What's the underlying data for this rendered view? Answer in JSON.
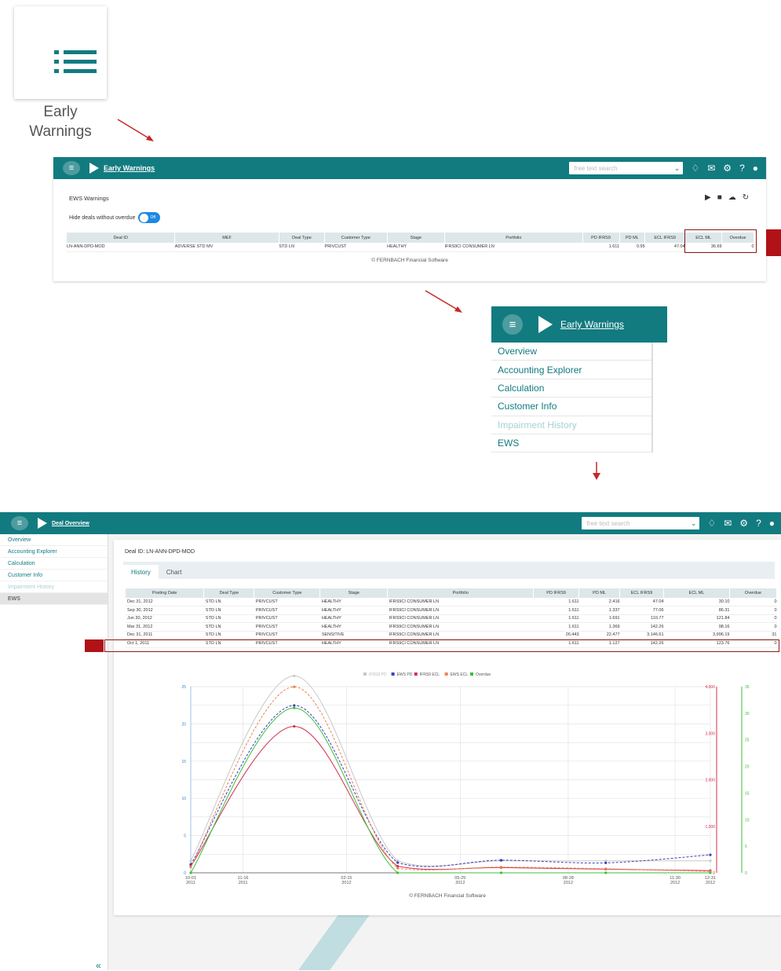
{
  "tile": {
    "icon": "list-icon",
    "label_line1": "Early",
    "label_line2": "Warnings"
  },
  "panel1": {
    "brand": "Early Warnings",
    "search_placeholder": "free text search",
    "section_title": "EWS Warnings",
    "toggle_label": "Hide deals without overdue",
    "toggle_state": "Off",
    "columns": [
      "Deal ID",
      "MEF",
      "Deal Type",
      "Customer Type",
      "Stage",
      "Portfolio",
      "PD IFRS9",
      "PD ML",
      "ECL IFRS9",
      "ECL ML",
      "Overdue"
    ],
    "row": [
      "LN-ANN-DPD-MOD",
      "ADVERSE STD MV",
      "STD LN",
      "PRIVCUST",
      "HEALTHY",
      "IFRS9CI CONSUMER LN",
      "1.611",
      "0.95",
      "47.04",
      "36.69",
      "0"
    ],
    "footer": "© FERNBACH Financial Software"
  },
  "menu": {
    "brand": "Early Warnings",
    "items": [
      "Overview",
      "Accounting Explorer",
      "Calculation",
      "Customer Info",
      "Impairment History",
      "EWS"
    ]
  },
  "app": {
    "brand": "Deal Overview",
    "search_placeholder": "free text search",
    "sidebar": [
      "Overview",
      "Accounting Explorer",
      "Calculation",
      "Customer Info",
      "Impairment History",
      "EWS"
    ],
    "collapse_glyph": "«",
    "deal_id": "Deal ID: LN-ANN-DPD-MOD",
    "tabs": [
      "History",
      "Chart"
    ],
    "columns": [
      "Posting Date",
      "Deal Type",
      "Customer Type",
      "Stage",
      "Portfolio",
      "PD IFRS9",
      "PD ML",
      "ECL IFRS9",
      "ECL ML",
      "Overdue"
    ],
    "rows": [
      [
        "Dec 31, 2012",
        "STD LN",
        "PRIVCUST",
        "HEALTHY",
        "IFRS9CI CONSUMER LN",
        "1.611",
        "2.416",
        "47.04",
        "30.10",
        "0"
      ],
      [
        "Sep 30, 2012",
        "STD LN",
        "PRIVCUST",
        "HEALTHY",
        "IFRS9CI CONSUMER LN",
        "1.611",
        "1.337",
        "77.06",
        "86.31",
        "0"
      ],
      [
        "Jun 30, 2012",
        "STD LN",
        "PRIVCUST",
        "HEALTHY",
        "IFRS9CI CONSUMER LN",
        "1.611",
        "1.691",
        "110.77",
        "121.84",
        "0"
      ],
      [
        "Mar 31, 2012",
        "STD LN",
        "PRIVCUST",
        "HEALTHY",
        "IFRS9CI CONSUMER LN",
        "1.611",
        "1.369",
        "142.26",
        "98.16",
        "0"
      ],
      [
        "Dec 31, 2011",
        "STD LN",
        "PRIVCUST",
        "SENSITIVE",
        "IFRS9CI CONSUMER LN",
        "26.443",
        "22.477",
        "3,146.61",
        "3,996.19",
        "31"
      ],
      [
        "Oct 1, 2011",
        "STD LN",
        "PRIVCUST",
        "HEALTHY",
        "IFRS9CI CONSUMER LN",
        "1.611",
        "1.127",
        "142.26",
        "123.76",
        "0"
      ]
    ],
    "footer": "© FERNBACH Financial Software"
  },
  "chart_data": {
    "type": "line",
    "legend": [
      "IFRS9 PD",
      "EWS PD",
      "IFRS9 ECL",
      "EWS ECL",
      "Overdue"
    ],
    "legend_position": "top",
    "x_ticks": [
      "10-01\n2011",
      "11-16\n2011",
      "02-15\n2012",
      "05-25\n2012",
      "08-28\n2012",
      "11-30\n2012",
      "12-31\n2012"
    ],
    "x": [
      "2011-10-01",
      "2011-12-31",
      "2012-03-31",
      "2012-06-30",
      "2012-09-30",
      "2012-12-31"
    ],
    "left_axis_ticks": [
      "0",
      "5",
      "10",
      "15",
      "20",
      "25"
    ],
    "right_axis1_ticks": [
      "0",
      "1,000",
      "2,000",
      "3,000",
      "4,000"
    ],
    "right_axis2_ticks": [
      "0",
      "5",
      "10",
      "15",
      "20",
      "25",
      "30",
      "35"
    ],
    "series": [
      {
        "name": "IFRS9 PD",
        "color": "#c8c8c8",
        "values": [
          1.611,
          26.443,
          1.611,
          1.611,
          1.611,
          1.611
        ]
      },
      {
        "name": "EWS PD",
        "color": "#3b3fb6",
        "values": [
          1.127,
          22.477,
          1.369,
          1.691,
          1.337,
          2.416
        ]
      },
      {
        "name": "IFRS9 ECL",
        "color": "#d32f4f",
        "values": [
          142.26,
          3146.61,
          142.26,
          110.77,
          77.06,
          47.04
        ]
      },
      {
        "name": "EWS ECL",
        "color": "#e8834f",
        "values": [
          123.76,
          3996.19,
          98.16,
          121.84,
          86.31,
          30.1
        ]
      },
      {
        "name": "Overdue",
        "color": "#3bbf3b",
        "values": [
          0,
          31,
          0,
          0,
          0,
          0
        ]
      }
    ],
    "ylim_left": [
      0,
      25
    ],
    "ylim_right1": [
      0,
      4000
    ],
    "ylim_right2": [
      0,
      35
    ]
  }
}
